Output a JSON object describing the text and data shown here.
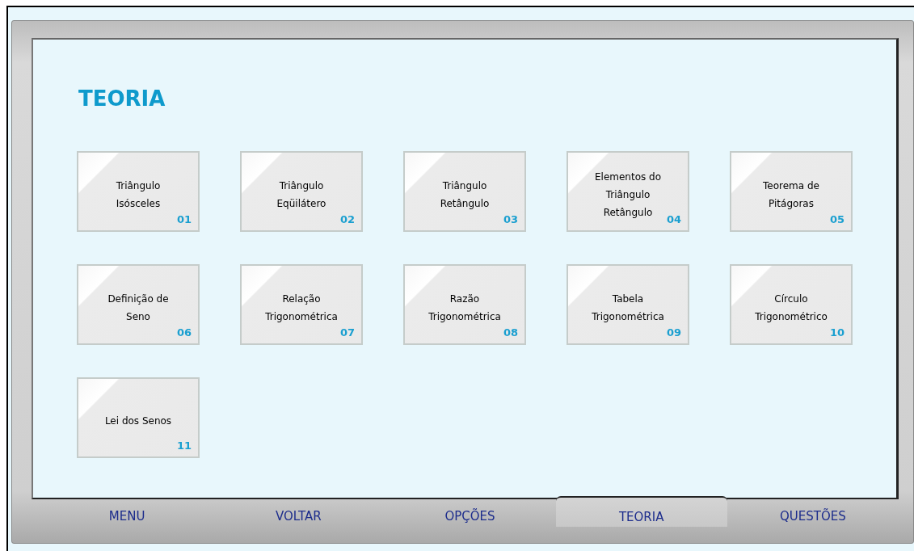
{
  "title": "TEORIA",
  "topics": [
    {
      "label": "Triângulo\nIsósceles",
      "number": "01"
    },
    {
      "label": "Triângulo\nEqüilátero",
      "number": "02"
    },
    {
      "label": "Triângulo\nRetângulo",
      "number": "03"
    },
    {
      "label": "Elementos do\nTriângulo\nRetângulo",
      "number": "04"
    },
    {
      "label": "Teorema de\nPitágoras",
      "number": "05"
    },
    {
      "label": "Definição de\nSeno",
      "number": "06"
    },
    {
      "label": "Relação\nTrigonométrica",
      "number": "07"
    },
    {
      "label": "Razão\nTrigonométrica",
      "number": "08"
    },
    {
      "label": "Tabela\nTrigonométrica",
      "number": "09"
    },
    {
      "label": "Círculo\nTrigonométrico",
      "number": "10"
    },
    {
      "label": "Lei dos Senos",
      "number": "11"
    }
  ],
  "nav": [
    {
      "label": "MENU",
      "selected": false
    },
    {
      "label": "VOLTAR",
      "selected": false
    },
    {
      "label": "OPÇÕES",
      "selected": false
    },
    {
      "label": "TEORIA",
      "selected": true
    },
    {
      "label": "QUESTÕES",
      "selected": false
    }
  ]
}
